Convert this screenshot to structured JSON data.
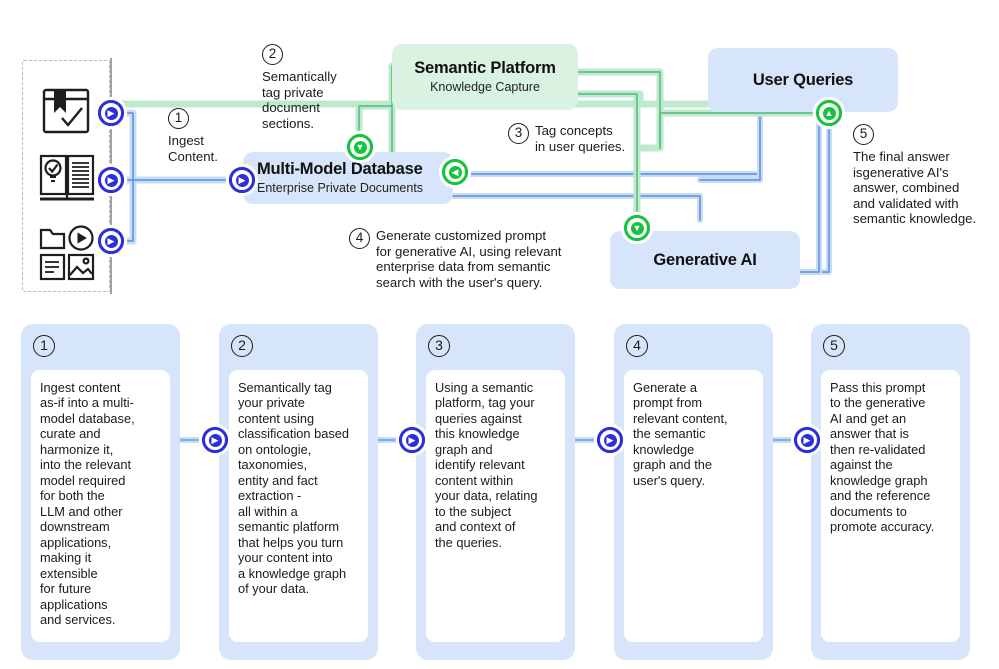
{
  "diagram": {
    "title_nodes": [
      {
        "id": "multi-model-database",
        "title": "Multi-Model Database",
        "subtitle": "Enterprise Private Documents",
        "color": "#d7e5fb"
      },
      {
        "id": "semantic-platform",
        "title": "Semantic Platform",
        "subtitle": "Knowledge Capture",
        "color": "#d9f2e1"
      },
      {
        "id": "user-queries",
        "title": "User Queries",
        "subtitle": "",
        "color": "#d7e5fb"
      },
      {
        "id": "generative-ai",
        "title": "Generative AI",
        "subtitle": "",
        "color": "#d7e5fb"
      }
    ],
    "annotations": [
      {
        "num": "1",
        "text": "Ingest\nContent."
      },
      {
        "num": "2",
        "text": "Semantically\ntag private\ndocument\nsections."
      },
      {
        "num": "3",
        "text": "Tag concepts\nin user queries."
      },
      {
        "num": "4",
        "text": "Generate customized prompt\nfor generative AI, using relevant\nenterprise data from semantic\nsearch with the user's query."
      },
      {
        "num": "5",
        "text": "The final answer\nisgenerative AI's\nanswer, combined\nand validated with\nsemantic knowledge."
      }
    ],
    "source_icons": [
      {
        "name": "bookmark-check-document-icon"
      },
      {
        "name": "open-book-idea-icon"
      },
      {
        "name": "folder-media-files-icon"
      }
    ]
  },
  "steps": [
    {
      "num": "1",
      "body": "Ingest content\nas-if into a multi-\nmodel database,\ncurate and\nharmonize it,\ninto the relevant\nmodel required\nfor both the\nLLM and other\ndownstream\napplications,\nmaking it\nextensible\nfor future\napplications\nand services."
    },
    {
      "num": "2",
      "body": "Semantically tag\nyour private\ncontent using\nclassification based\non ontologie,\ntaxonomies,\nentity and fact\nextraction -\nall within a\nsemantic platform\nthat helps you turn\nyour content into\na knowledge graph\nof your data."
    },
    {
      "num": "3",
      "body": "Using a semantic\nplatform, tag your\nqueries against\nthis knowledge\ngraph and\nidentify relevant\ncontent within\nyour data, relating\nto the subject\nand context of\nthe queries."
    },
    {
      "num": "4",
      "body": "Generate a\nprompt from\nrelevant content,\nthe semantic\nknowledge\ngraph and the\nuser's query."
    },
    {
      "num": "5",
      "body": "Pass this prompt\nto the generative\nAI and get an\nanswer that is\nthen re-validated\nagainst the\nknowledge graph\nand the reference\ndocuments to\npromote accuracy."
    }
  ],
  "colors": {
    "box_blue": "#d7e5fb",
    "box_green": "#d9f2e1",
    "wire_blue": "#7aa7e8",
    "wire_green": "#7fd3a0",
    "knob_blue": "#2f2fd6",
    "knob_green": "#17c23f"
  }
}
